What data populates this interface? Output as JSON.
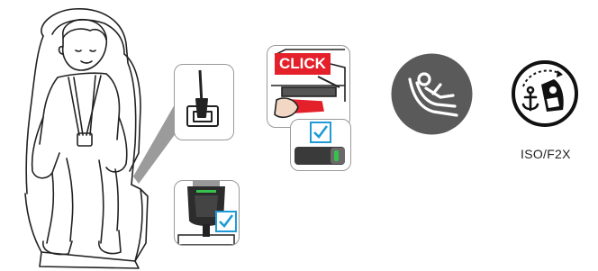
{
  "labels": {
    "click": "CLICK",
    "iso_caption": "ISO/F2X"
  },
  "icons": {
    "child_seat_illustration": "child-in-car-seat-icon",
    "buckle_closeup": "seat-buckle-icon",
    "isofix_click": "isofix-click-icon",
    "isofix_indicator": "isofix-green-indicator-icon",
    "harness_adjuster": "harness-adjuster-icon",
    "recline": "recline-seat-icon",
    "isofix_anchor": "isofix-anchor-seat-icon"
  },
  "colors": {
    "check_accent": "#1e9bd7",
    "click_red": "#e4202b",
    "indicator_green": "#36c24a",
    "icon_dark": "#5a5a5a"
  }
}
